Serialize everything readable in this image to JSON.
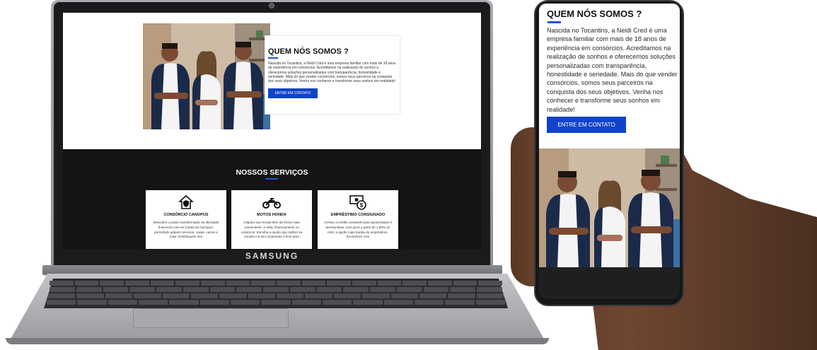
{
  "laptop": {
    "brand": "SAMSUNG",
    "about": {
      "title": "QUEM NÓS SOMOS ?",
      "text": "Nascida no Tocantins, a Neidi Cred é uma empresa familiar com mais de 18 anos de experiência em consórcios. Acreditamos na realização de sonhos e oferecemos soluções personalizadas com transparência, honestidade e seriedade. Mais do que vender consórcios, somos seus parceiros na conquista dos seus objetivos. Venha nos conhecer e transforme seus sonhos em realidade!",
      "button": "ENTRE EM CONTATO"
    },
    "services": {
      "title": "NOSSOS SERVIÇOS",
      "items": [
        {
          "icon": "house-shield-icon",
          "name": "CONSÓRCIO CANOPUS",
          "desc": "Descubra o poder transformador da liberdade financeira com as Cartas do Canopus, permitindo adquirir terrenos, casas, carros e mais. Desbloqueie seu"
        },
        {
          "icon": "motorcycle-icon",
          "name": "MOTOS HONDA",
          "desc": "Adquira sua Honda 0km da forma mais conveniente: à vista, financiamento ou consórcio. Escolha a opção que melhor se encaixa no seu orçamento e leve para"
        },
        {
          "icon": "money-icon",
          "name": "EMPRÉSTIMO CONSIGNADO",
          "desc": "Acesso a crédito acessível para aposentados e pensionistas, com juros a partir de 1,85% ao mês, a opção mais barata de empréstimo. Economize com"
        }
      ]
    }
  },
  "phone": {
    "about": {
      "title": "QUEM NÓS SOMOS ?",
      "text": "Nascida no Tocantins, a Neidi Cred é uma empresa familiar com mais de 18 anos de experiência em consórcios. Acreditamos na realização de sonhos e oferecemos soluções personalizadas com transparência, honestidade e seriedade. Mais do que vender consórcios, somos seus parceiros na conquista dos seus objetivos. Venha nos conhecer e transforme seus sonhos em realidade!",
      "button": "ENTRE EM CONTATO"
    }
  },
  "colors": {
    "accent": "#1043c8",
    "dark_section": "#141414",
    "underline": "#1a56d6"
  }
}
